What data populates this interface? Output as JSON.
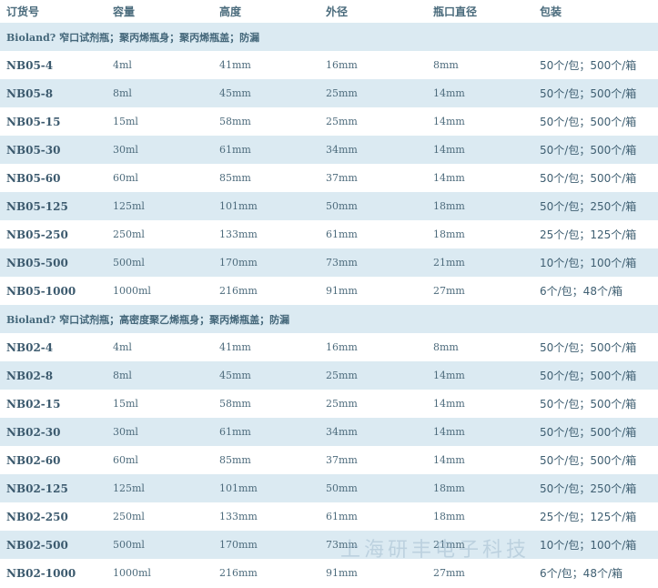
{
  "header": [
    "订货号",
    "容量",
    "高度",
    "外径",
    "瓶口直径",
    "包装"
  ],
  "sections": [
    {
      "title": "Bioland? 窄口试剂瓶；聚丙烯瓶身；聚丙烯瓶盖；防漏",
      "rows": [
        [
          "NB05-4",
          "4ml",
          "41mm",
          "16mm",
          "8mm",
          "50个/包；500个/箱"
        ],
        [
          "NB05-8",
          "8ml",
          "45mm",
          "25mm",
          "14mm",
          "50个/包；500个/箱"
        ],
        [
          "NB05-15",
          "15ml",
          "58mm",
          "25mm",
          "14mm",
          "50个/包；500个/箱"
        ],
        [
          "NB05-30",
          "30ml",
          "61mm",
          "34mm",
          "14mm",
          "50个/包；500个/箱"
        ],
        [
          "NB05-60",
          "60ml",
          "85mm",
          "37mm",
          "14mm",
          "50个/包；500个/箱"
        ],
        [
          "NB05-125",
          "125ml",
          "101mm",
          "50mm",
          "18mm",
          "50个/包；250个/箱"
        ],
        [
          "NB05-250",
          "250ml",
          "133mm",
          "61mm",
          "18mm",
          "25个/包；125个/箱"
        ],
        [
          "NB05-500",
          "500ml",
          "170mm",
          "73mm",
          "21mm",
          "10个/包；100个/箱"
        ],
        [
          "NB05-1000",
          "1000ml",
          "216mm",
          "91mm",
          "27mm",
          "6个/包；48个/箱"
        ]
      ]
    },
    {
      "title": "Bioland? 窄口试剂瓶；高密度聚乙烯瓶身；聚丙烯瓶盖；防漏",
      "rows": [
        [
          "NB02-4",
          "4ml",
          "41mm",
          "16mm",
          "8mm",
          "50个/包；500个/箱"
        ],
        [
          "NB02-8",
          "8ml",
          "45mm",
          "25mm",
          "14mm",
          "50个/包；500个/箱"
        ],
        [
          "NB02-15",
          "15ml",
          "58mm",
          "25mm",
          "14mm",
          "50个/包；500个/箱"
        ],
        [
          "NB02-30",
          "30ml",
          "61mm",
          "34mm",
          "14mm",
          "50个/包；500个/箱"
        ],
        [
          "NB02-60",
          "60ml",
          "85mm",
          "37mm",
          "14mm",
          "50个/包；500个/箱"
        ],
        [
          "NB02-125",
          "125ml",
          "101mm",
          "50mm",
          "18mm",
          "50个/包；250个/箱"
        ],
        [
          "NB02-250",
          "250ml",
          "133mm",
          "61mm",
          "18mm",
          "25个/包；125个/箱"
        ],
        [
          "NB02-500",
          "500ml",
          "170mm",
          "73mm",
          "21mm",
          "10个/包；100个/箱"
        ],
        [
          "NB02-1000",
          "1000ml",
          "216mm",
          "91mm",
          "27mm",
          "6个/包；48个/箱"
        ]
      ]
    }
  ],
  "watermark": "上海研丰电子科技",
  "colors": {
    "shade": "#dbeaf2",
    "text": "#3f5f72"
  }
}
